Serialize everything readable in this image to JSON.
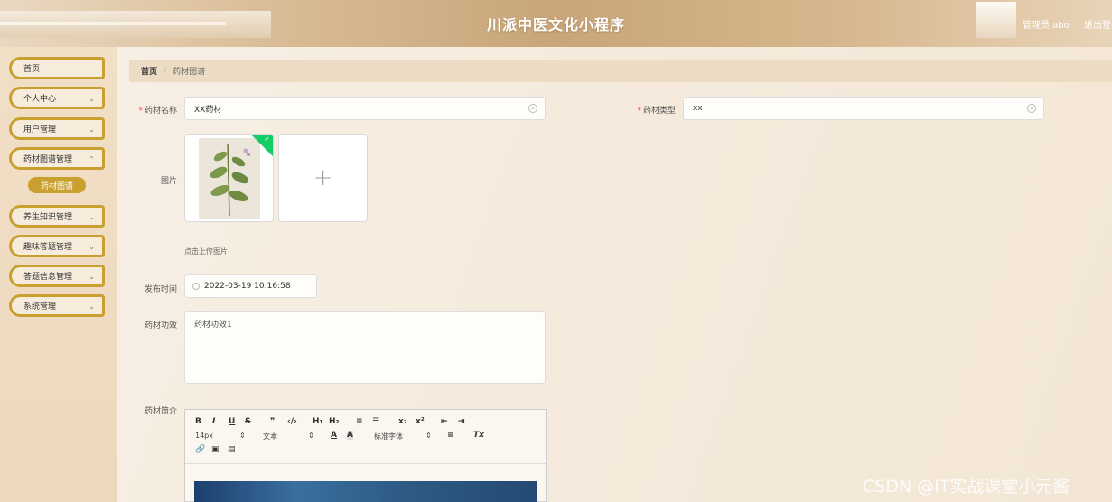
{
  "header": {
    "title": "川派中医文化小程序",
    "user": "管理员 abo",
    "logout": "退出登"
  },
  "sidebar": {
    "items": [
      {
        "label": "首页",
        "has_chevron": false
      },
      {
        "label": "个人中心",
        "has_chevron": true
      },
      {
        "label": "用户管理",
        "has_chevron": true
      },
      {
        "label": "药材图谱管理",
        "has_chevron": true
      },
      {
        "label": "养生知识管理",
        "has_chevron": true
      },
      {
        "label": "趣味答题管理",
        "has_chevron": true
      },
      {
        "label": "答题信息管理",
        "has_chevron": true
      },
      {
        "label": "系统管理",
        "has_chevron": true
      }
    ],
    "sub_active": "药材图谱"
  },
  "breadcrumb": {
    "home": "首页",
    "separator": "/",
    "current": "药材图谱"
  },
  "form": {
    "name_label": "药材名称",
    "name_value": "XX药材",
    "type_label": "药材类型",
    "type_value": "xx",
    "image_label": "图片",
    "upload_hint": "点击上传图片",
    "date_label": "发布时间",
    "date_value": "2022-03-19 10:16:58",
    "effect_label": "药材功效",
    "effect_value": "药材功效1",
    "intro_label": "药材简介"
  },
  "editor": {
    "font_size": "14px",
    "text_format": "文本",
    "font_family": "标准字体"
  },
  "icons": {
    "clear": "clear-icon",
    "clock": "clock-icon",
    "plus": "plus-icon",
    "check": "check-icon"
  },
  "colors": {
    "accent": "#c9a02f",
    "success": "#13ce66",
    "required": "#e55555"
  },
  "watermark": "CSDN @IT实战课堂小元酱"
}
